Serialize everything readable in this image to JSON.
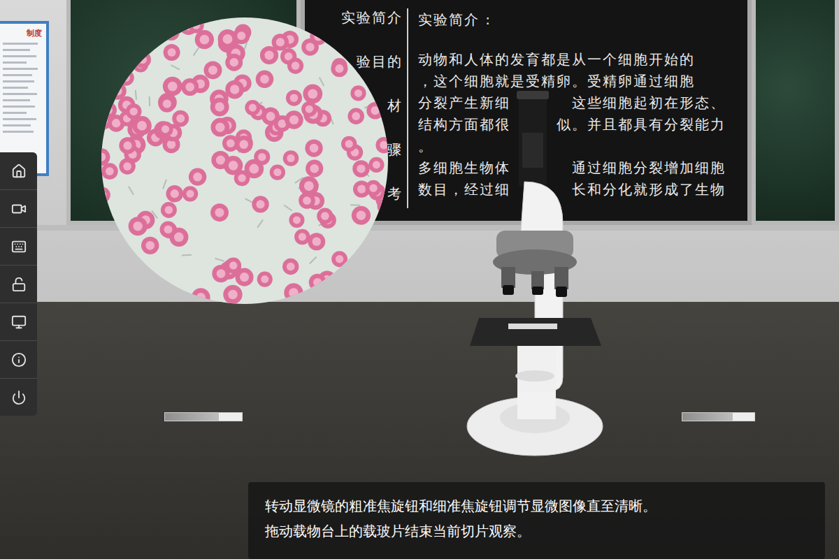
{
  "notice_board": {
    "title": "制度"
  },
  "blackboard": {
    "menu": [
      "实验简介",
      "验目的",
      "材",
      "骤",
      "考"
    ],
    "title": "实验简介 :",
    "lines": [
      [
        "动物和人体的发育都是从一个细胞开始的"
      ],
      [
        "，这个细胞就是受精卵。受精卵通过细胞"
      ],
      [
        "分裂产生新细",
        "这些细胞起初在形态、"
      ],
      [
        "结构方面都很",
        "似。并且都具有分裂能力"
      ],
      [
        "。"
      ],
      [
        "多细胞生物体",
        "通过细胞分裂增加细胞"
      ],
      [
        "数目，经过细",
        "长和分化就形成了生物"
      ]
    ]
  },
  "caption": [
    "转动显微镜的粗准焦旋钮和细准焦旋钮调节显微图像直至清晰。",
    "拖动载物台上的载玻片结束当前切片观察。"
  ]
}
